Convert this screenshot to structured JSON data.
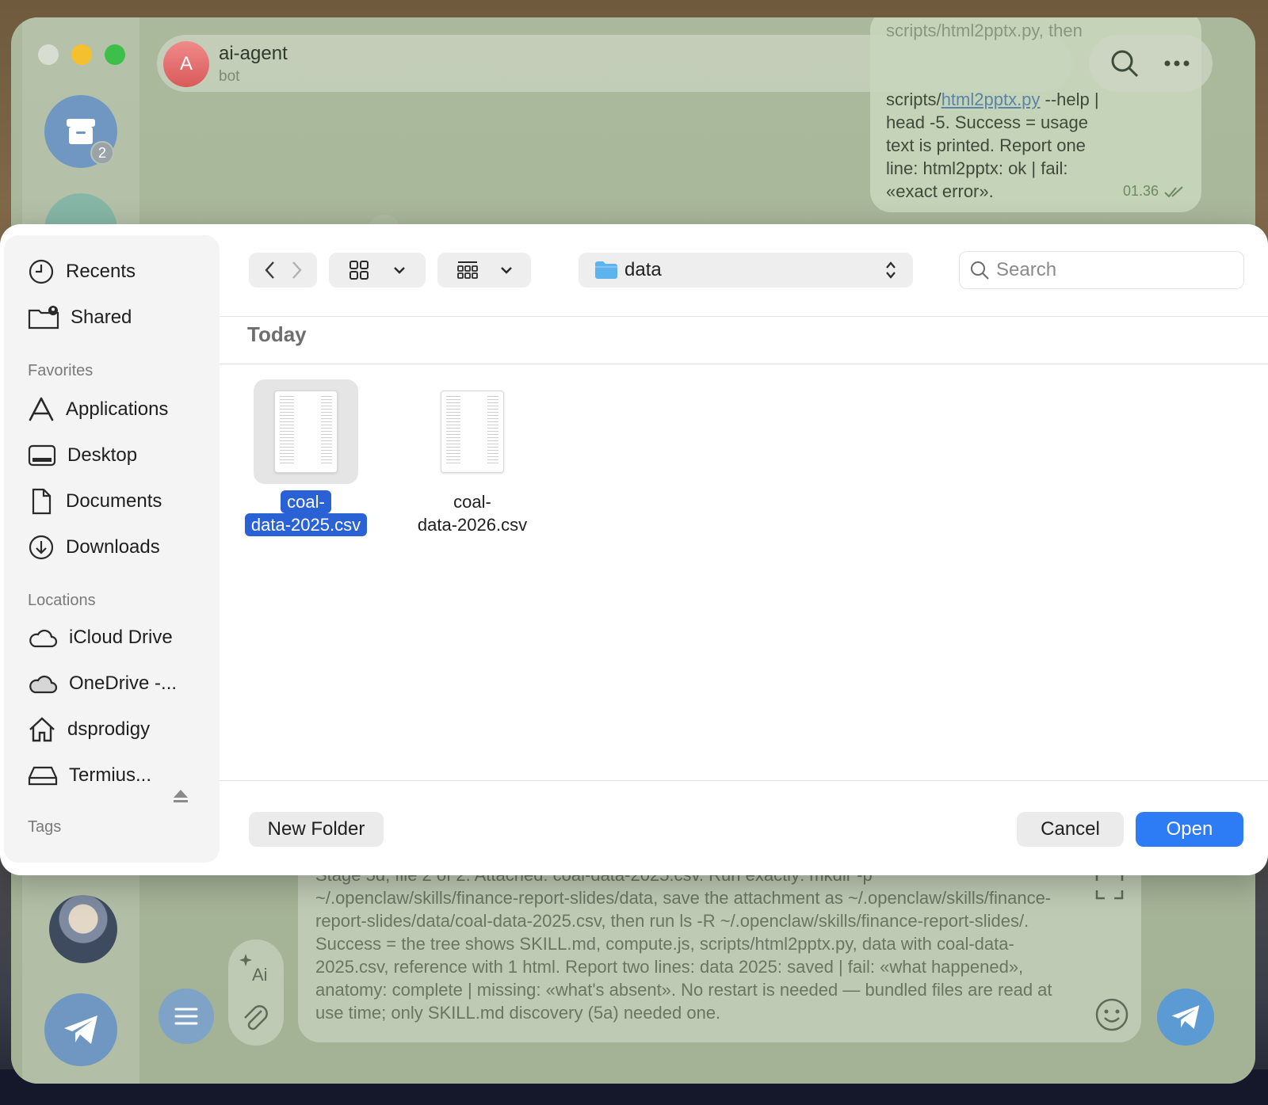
{
  "telegram": {
    "chat": {
      "avatar_letter": "A",
      "name": "ai-agent",
      "status": "bot"
    },
    "archive_badge": "2",
    "message": {
      "line0": "scripts/html2pptx.py, then",
      "line_pre": "scripts/",
      "line_link": "html2pptx.py",
      "line_post": " --help |",
      "line2": "head -5. Success = usage",
      "line3": "text is printed. Report one",
      "line4": "line: html2pptx: ok | fail:",
      "line5": "«exact error».",
      "time": "01.36"
    },
    "composer_text": "Stage 5d, file 2 of 2. Attached: coal-data-2025.csv. Run exactly: mkdir -p ~/.openclaw/skills/finance-report-slides/data, save the attachment as ~/.openclaw/skills/finance-report-slides/data/coal-data-2025.csv, then run ls -R ~/.openclaw/skills/finance-report-slides/. Success = the tree shows SKILL.md, compute.js, scripts/html2pptx.py, data with coal-data-2025.csv, reference with 1 html. Report two lines: data 2025: saved | fail: «what happened», anatomy: complete | missing: «what's absent». No restart is needed — bundled files are read at use time; only SKILL.md discovery (5a) needed one."
  },
  "dialog": {
    "sidebar": {
      "items_top": [
        {
          "label": "Recents",
          "icon": "clock-icon"
        },
        {
          "label": "Shared",
          "icon": "shared-folder-icon"
        }
      ],
      "favorites_title": "Favorites",
      "favorites": [
        {
          "label": "Applications",
          "icon": "applications-icon"
        },
        {
          "label": "Desktop",
          "icon": "desktop-icon"
        },
        {
          "label": "Documents",
          "icon": "document-icon"
        },
        {
          "label": "Downloads",
          "icon": "download-icon"
        }
      ],
      "locations_title": "Locations",
      "locations": [
        {
          "label": "iCloud Drive",
          "icon": "cloud-icon"
        },
        {
          "label": "OneDrive -...",
          "icon": "cloud-filled-icon"
        },
        {
          "label": "dsprodigy",
          "icon": "home-icon"
        },
        {
          "label": "Termius...",
          "icon": "drive-icon"
        }
      ],
      "tags_title": "Tags"
    },
    "location": "data",
    "search_placeholder": "Search",
    "group_title": "Today",
    "files": [
      {
        "line1": "coal-",
        "line2": "data-2025.csv",
        "selected": true
      },
      {
        "line1": "coal-",
        "line2": "data-2026.csv",
        "selected": false
      }
    ],
    "buttons": {
      "new_folder": "New Folder",
      "cancel": "Cancel",
      "open": "Open"
    },
    "accent_color": "#2d7cf6"
  }
}
